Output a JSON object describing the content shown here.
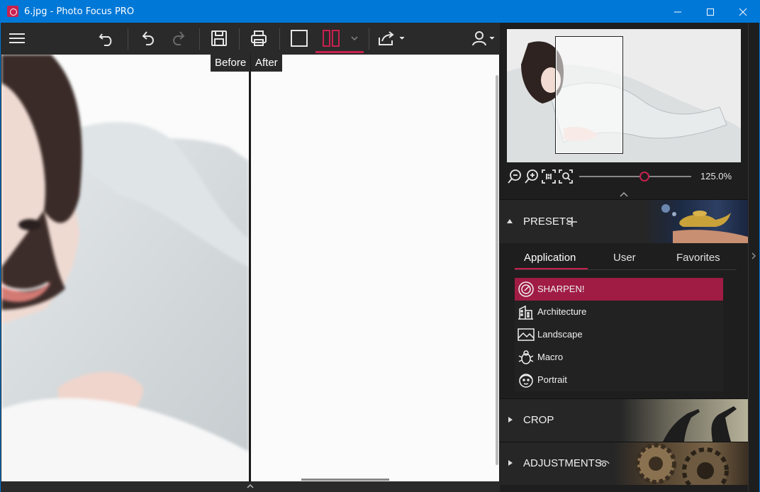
{
  "window": {
    "title": "6.jpg - Photo Focus PRO",
    "brand_color": "#c8214f",
    "titlebar_color": "#0078d7"
  },
  "toolbar": {
    "icons": [
      "menu-icon",
      "undo-icon",
      "redo-icon",
      "redo-disabled-icon",
      "save-icon",
      "print-icon",
      "single-view-icon",
      "split-view-icon",
      "dropdown-icon",
      "share-icon",
      "user-icon"
    ]
  },
  "compare": {
    "before_label": "Before",
    "after_label": "After"
  },
  "navigator": {
    "zoom_value": "125.0%",
    "zoom_fraction": 0.58
  },
  "presets": {
    "header": "PRESETS",
    "tabs": [
      "Application",
      "User",
      "Favorites"
    ],
    "active_tab": "Application",
    "items": [
      {
        "label": "SHARPEN!",
        "icon": "sharpen-icon",
        "selected": true
      },
      {
        "label": "Architecture",
        "icon": "building-icon",
        "selected": false
      },
      {
        "label": "Landscape",
        "icon": "landscape-icon",
        "selected": false
      },
      {
        "label": "Macro",
        "icon": "bug-icon",
        "selected": false
      },
      {
        "label": "Portrait",
        "icon": "face-icon",
        "selected": false
      }
    ]
  },
  "sections": {
    "crop": "CROP",
    "adjustments": "ADJUSTMENTS"
  }
}
